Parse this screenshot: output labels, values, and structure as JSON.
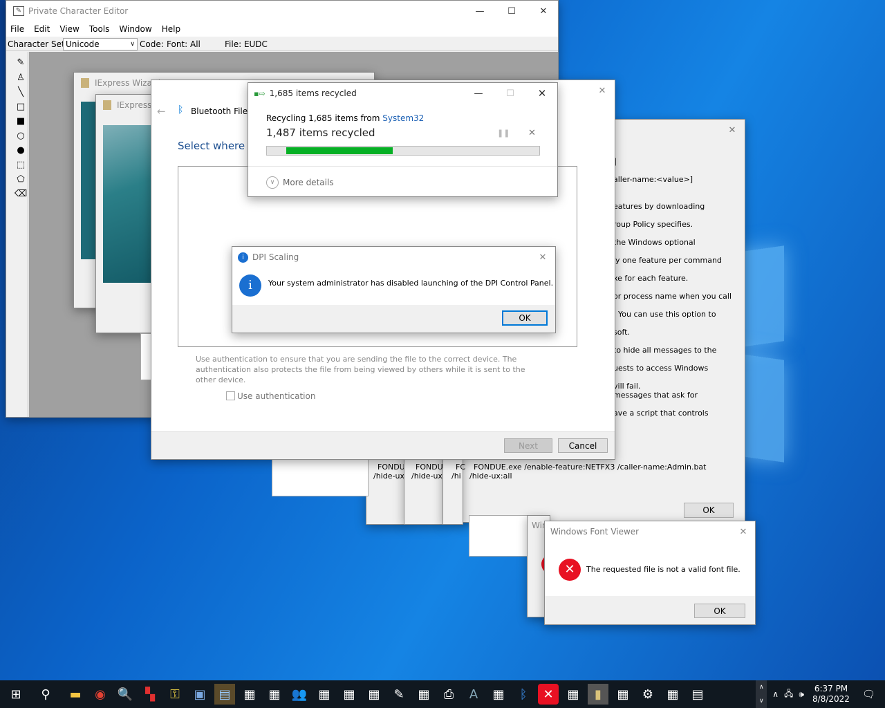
{
  "pce": {
    "title": "Private Character Editor",
    "menu": [
      "File",
      "Edit",
      "View",
      "Tools",
      "Window",
      "Help"
    ],
    "charset_label": "Character Set:",
    "charset_value": "Unicode",
    "code_label": "Code:",
    "font_label": "Font: All",
    "file_label": "File: EUDC"
  },
  "iexpress1": {
    "title": "IExpress Wizard"
  },
  "iexpress2": {
    "title": "IExpress W"
  },
  "bluetooth": {
    "title": "Bluetooth File T",
    "heading": "Select where to",
    "auth_text": "Use authentication to ensure that you are sending the file to the correct device. The authentication also protects the file from being viewed by others while it is sent to the other device.",
    "auth_checkbox": "Use authentication",
    "next_btn": "Next",
    "cancel_btn": "Cancel"
  },
  "recycle": {
    "title": "1,685 items recycled",
    "line1_prefix": "Recycling 1,685 items from ",
    "line1_link": "System32",
    "status": "1,487 items recycled",
    "progress": 0.39,
    "more_details": "More details",
    "pause_icon": "pause-icon",
    "accent": "#06b025"
  },
  "dpi": {
    "title": "DPI Scaling",
    "message": "Your system administrator has disabled launching of the DPI Control Panel.",
    "ok": "OK"
  },
  "fondue": {
    "lines": [
      "aller-name:<value>]",
      "eatures by downloading",
      "roup Policy specifies.",
      " the Windows optional",
      "ly one feature per command",
      "xe for each feature.",
      "or process name when you call",
      ". You can use this option to",
      "soft.",
      "to hide all messages to the",
      "uests to access Windows",
      "vill fail.",
      "messages that ask for",
      "ave a script that controls"
    ],
    "cmd1": "FONDUE.exe /enable-feature:NETFX3 /caller-name:Admin.bat",
    "cmd2": "/hide-ux:all",
    "stack_a": [
      "FONDU",
      "/hide-ux"
    ],
    "stack_b": [
      "FONDU",
      "/hide-ux:"
    ],
    "stack_c": [
      "FC",
      "/hi"
    ],
    "ok": "OK",
    "bracket": "]"
  },
  "fontviewer_back": {
    "title": "Wir"
  },
  "fontviewer": {
    "title": "Windows Font Viewer",
    "message": "The requested file  is not a valid font file.",
    "ok": "OK"
  },
  "taskbar": {
    "time": "6:37 PM",
    "date": "8/8/2022"
  }
}
